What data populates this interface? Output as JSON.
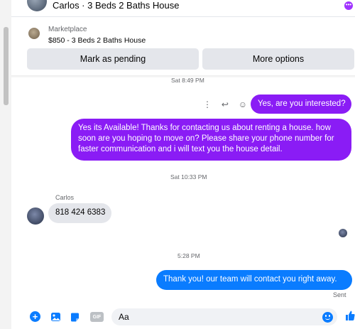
{
  "header": {
    "contact_title": "Carlos · 3 Beds 2 Baths House",
    "more_icon": "ellipsis-icon"
  },
  "marketplace": {
    "label": "Marketplace",
    "item": "$850 - 3 Beds 2 Baths House",
    "mark_pending_label": "Mark as pending",
    "more_options_label": "More options"
  },
  "timestamps": {
    "t1": "Sat 8:49 PM",
    "t2": "Sat 10:33 PM",
    "t3": "5:28 PM"
  },
  "messages": {
    "m1": "Yes, are you interested?",
    "m2": "Yes its Available! Thanks for contacting us about renting a house. how soon are you hoping to move on? Please share your phone number for faster communication and i will text you the house detail.",
    "sender_name": "Carlos",
    "m3": "818 424 6383",
    "m4": "Thank you! our team will contact you right away.",
    "status": "Sent"
  },
  "composer": {
    "placeholder": "Aa",
    "gif_label": "GIF"
  },
  "colors": {
    "purple_bubble": "#8a1cf5",
    "blue_bubble": "#0a7cff",
    "incoming_bubble": "#e4e6eb",
    "accent": "#0a7cff"
  }
}
